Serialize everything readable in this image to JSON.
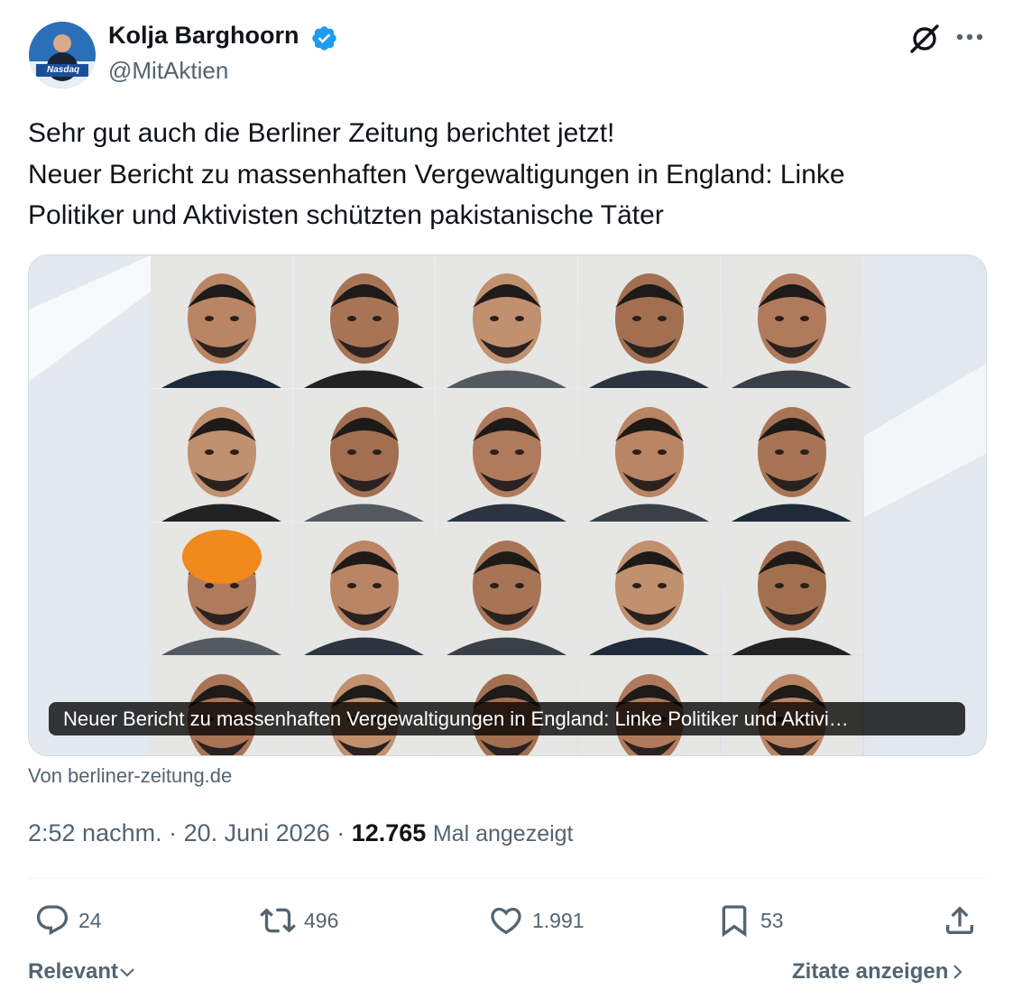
{
  "author": {
    "name": "Kolja Barghoorn",
    "handle": "@MitAktien",
    "avatar_caption": "Nasdaq",
    "verified": true
  },
  "tweet": {
    "lines": [
      "Sehr gut auch die Berliner Zeitung berichtet jetzt!",
      "Neuer Bericht zu massenhaften Vergewaltigungen in England: Linke",
      "Politiker und Aktivisten schützten pakistanische Täter"
    ]
  },
  "card": {
    "caption": "Neuer Bericht zu massenhaften Vergewaltigungen in England: Linke Politiker und Aktivi…",
    "source": "Von berliner-zeitung.de",
    "photo_grid": {
      "rows": 4,
      "cols": 5
    }
  },
  "meta": {
    "time": "2:52 nachm.",
    "separator": " · ",
    "date": "20. Juni 2026",
    "views": "12.765",
    "views_label": "Mal angezeigt"
  },
  "actions": {
    "replies": "24",
    "reposts": "496",
    "likes": "1.991",
    "bookmarks": "53"
  },
  "footer": {
    "sort_label": "Relevant",
    "quotes_label": "Zitate anzeigen"
  },
  "colors": {
    "text": "#0f1419",
    "secondary": "#536471",
    "verified": "#1d9bf0",
    "border": "#cfd9de"
  },
  "icons": [
    "grok-icon",
    "more-icon",
    "verified-icon",
    "reply-icon",
    "repost-icon",
    "like-icon",
    "bookmark-icon",
    "share-icon",
    "chevron-down-icon",
    "chevron-right-icon"
  ]
}
